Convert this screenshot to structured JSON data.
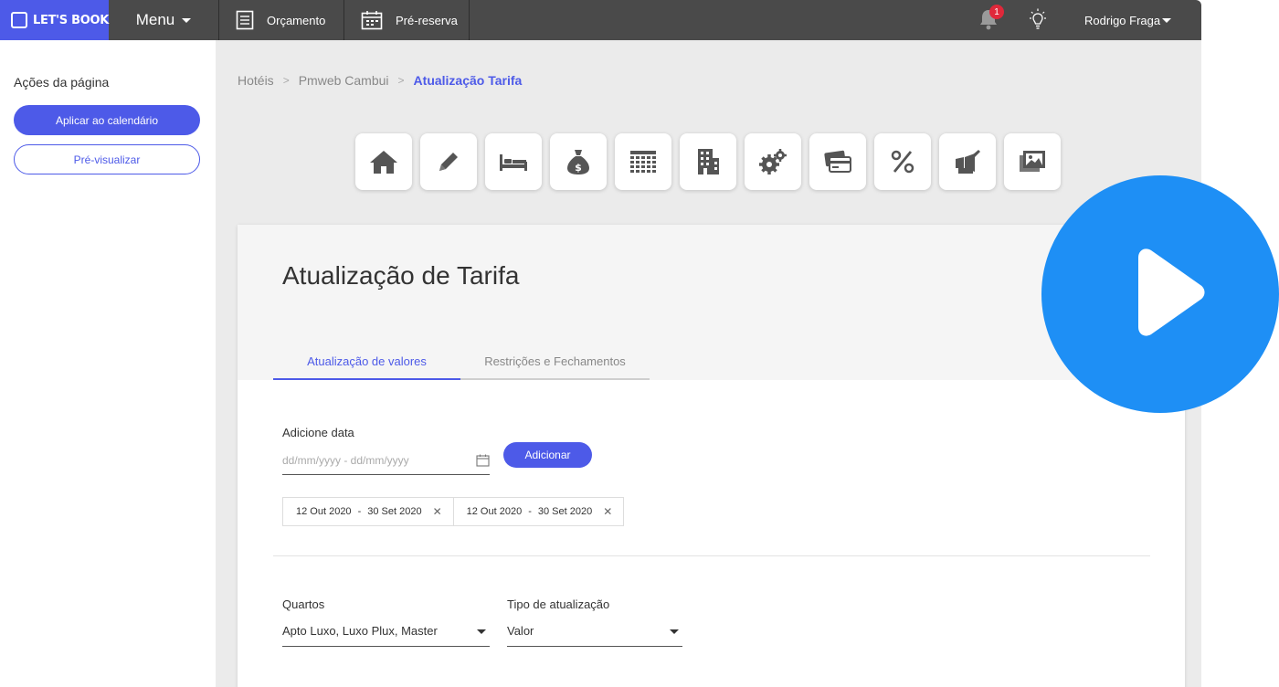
{
  "brand": {
    "logo_text": "LET'S BOOK"
  },
  "topbar": {
    "menu_label": "Menu",
    "nav": [
      {
        "label": "Orçamento",
        "icon": "document-icon"
      },
      {
        "label": "Pré-reserva",
        "icon": "calendar-icon"
      }
    ],
    "notifications_count": "1",
    "user_name": "Rodrigo Fraga"
  },
  "sidebar": {
    "title": "Ações da página",
    "apply_button": "Aplicar ao calendário",
    "preview_button": "Pré-visualizar"
  },
  "breadcrumb": [
    "Hotéis",
    "Pmweb Cambui",
    "Atualização Tarifa"
  ],
  "icon_toolbar": [
    "home-icon",
    "pencil-icon",
    "bed-icon",
    "money-bag-icon",
    "grid-icon",
    "building-icon",
    "gears-icon",
    "credit-card-icon",
    "percent-icon",
    "marketing-icon",
    "image-icon"
  ],
  "card": {
    "title": "Atualização de Tarifa",
    "tabs": [
      {
        "label": "Atualização de valores",
        "active": true
      },
      {
        "label": "Restrições e Fechamentos",
        "active": false
      }
    ],
    "date": {
      "label": "Adicione data",
      "placeholder": "dd/mm/yyyy - dd/mm/yyyy",
      "add_button": "Adicionar",
      "ranges": [
        {
          "start": "12 Out 2020",
          "end": "30 Set 2020"
        },
        {
          "start": "12 Out 2020",
          "end": "30 Set 2020"
        }
      ]
    },
    "rooms": {
      "label": "Quartos",
      "value": "Apto Luxo, Luxo Plux, Master"
    },
    "update_type": {
      "label": "Tipo de atualização",
      "value": "Valor"
    }
  },
  "colors": {
    "accent": "#4d5ae8",
    "topbar": "#4a4a4a",
    "play": "#1e8ff5",
    "badge": "#e0283a"
  }
}
